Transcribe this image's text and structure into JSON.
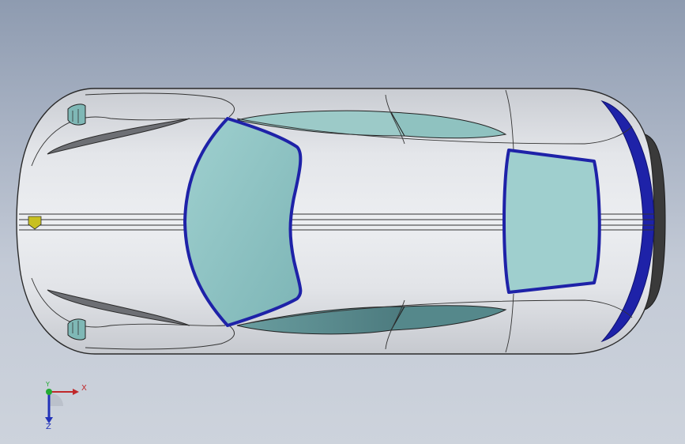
{
  "viewport": {
    "model": "car-top-view",
    "colors": {
      "background_top": "#8e9bb0",
      "background_bottom": "#cdd3dc",
      "body": "#d9dbe0",
      "glass": "#8fc4c4",
      "glass_dark": "#5f8e92",
      "trim": "#1e22a8",
      "edge": "#2a2a2a",
      "badge": "#c8c020",
      "tire": "#3a3a3a"
    }
  },
  "triad": {
    "x_label": "X",
    "y_label": "Y",
    "z_label": "Z",
    "x_color": "#c0282a",
    "y_color": "#22aa33",
    "z_color": "#2232b8"
  }
}
